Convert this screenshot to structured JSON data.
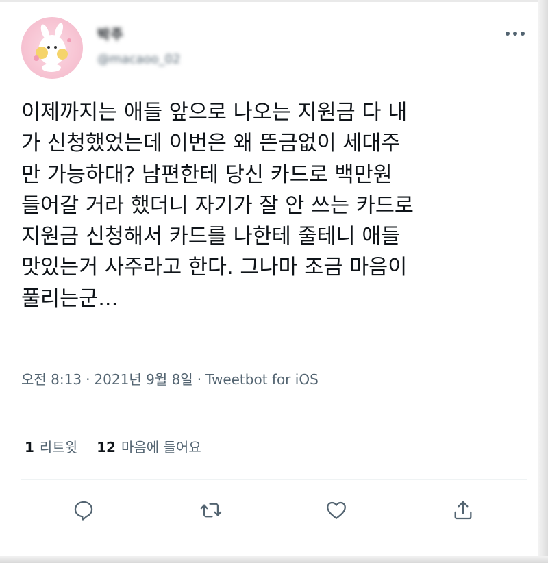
{
  "author": {
    "display_name": "박주",
    "handle": "@macaoo_02"
  },
  "tweet": {
    "lines": [
      "이제까지는 애들 앞으로 나오는 지원금 다 내",
      "가 신청했었는데 이번은 왜 뜬금없이 세대주",
      "만 가능하대? 남편한테 당신 카드로 백만원",
      "들어갈 거라 했더니 자기가 잘 안 쓰는 카드로",
      "지원금 신청해서 카드를 나한테 줄테니 애들",
      "맛있는거 사주라고 한다. 그나마 조금 마음이",
      "풀리는군..."
    ]
  },
  "meta": {
    "time": "오전 8:13",
    "date": "2021년 9월 8일",
    "separator": "·",
    "source": "Tweetbot for iOS"
  },
  "stats": {
    "retweets_count": "1",
    "retweets_label": "리트윗",
    "likes_count": "12",
    "likes_label": "마음에 들어요"
  },
  "icons": {
    "more": "more-horizontal-icon",
    "reply": "reply-icon",
    "retweet": "retweet-icon",
    "like": "heart-icon",
    "share": "share-icon"
  },
  "colors": {
    "text": "#0f1419",
    "secondary": "#536471",
    "divider": "#eff3f4",
    "avatar_bg": "#f7c4d3"
  }
}
